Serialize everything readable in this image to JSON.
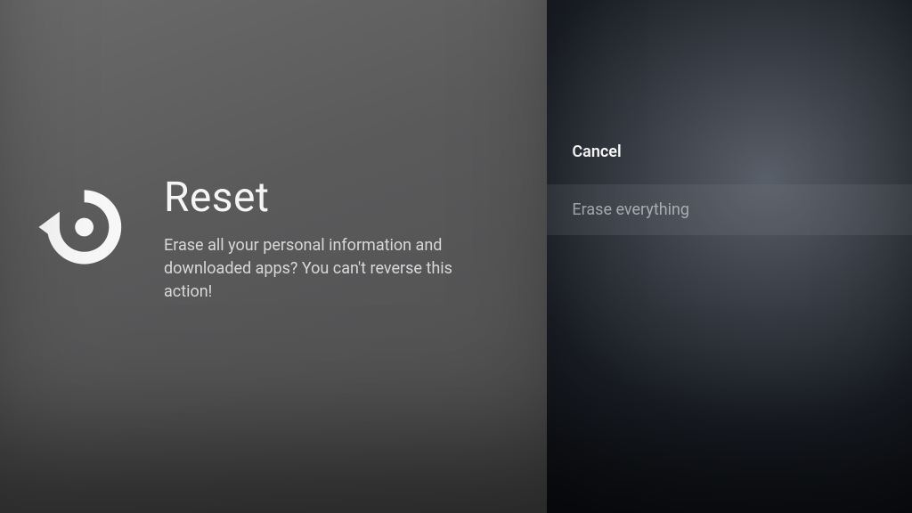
{
  "left": {
    "title": "Reset",
    "description": "Erase all your personal information and downloaded apps? You can't reverse this action!"
  },
  "options": {
    "cancel_label": "Cancel",
    "erase_label": "Erase everything"
  }
}
